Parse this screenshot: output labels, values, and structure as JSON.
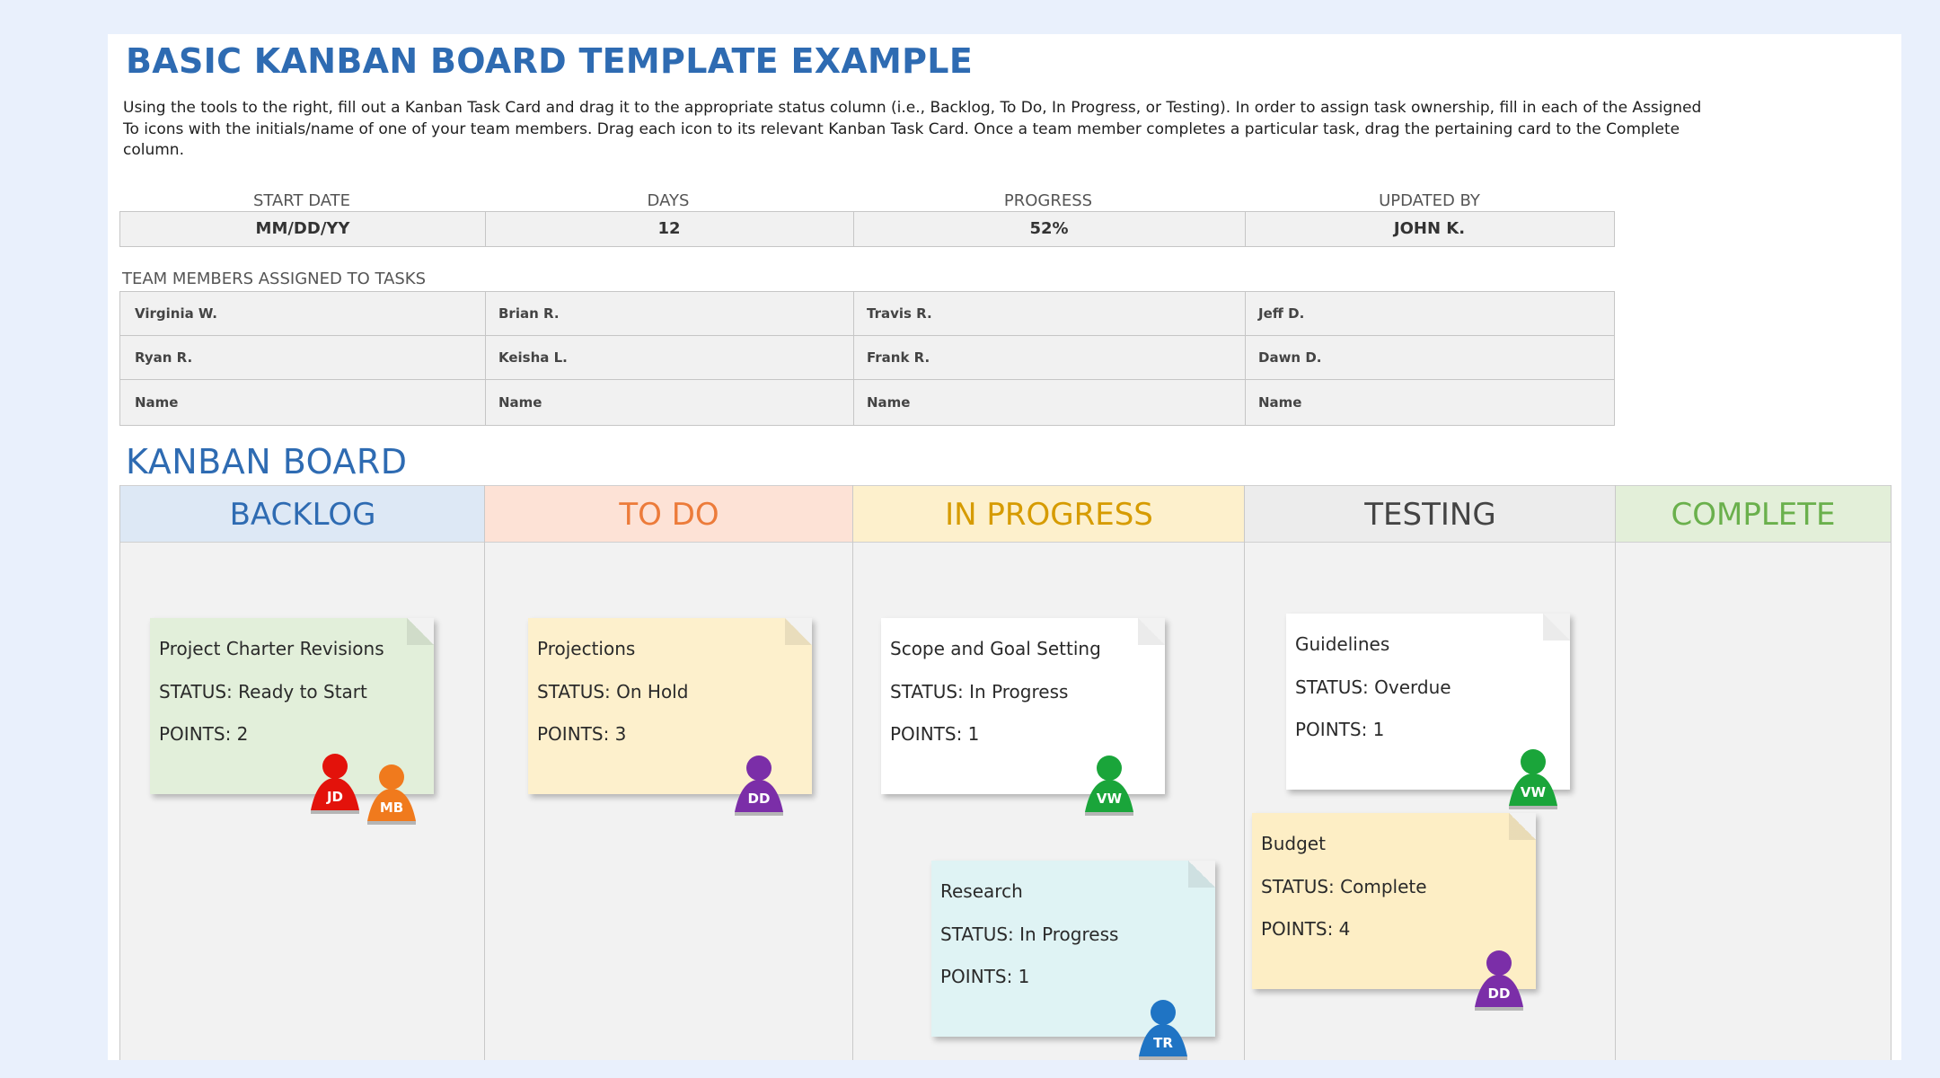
{
  "header": {
    "title": "BASIC KANBAN BOARD TEMPLATE EXAMPLE",
    "instructions": "Using the tools to the right, fill out a Kanban Task Card and drag it to the appropriate status column (i.e., Backlog, To Do, In Progress, or Testing). In order to assign task ownership, fill in each of the Assigned To icons with the initials/name of one of your team members. Drag each icon to its relevant Kanban Task Card. Once a team member completes a particular task, drag the pertaining card to the Complete column."
  },
  "summary": {
    "start_date_label": "START DATE",
    "start_date_value": "MM/DD/YY",
    "days_label": "DAYS",
    "days_value": "12",
    "progress_label": "PROGRESS",
    "progress_value": "52%",
    "updated_by_label": "UPDATED BY",
    "updated_by_value": "JOHN K."
  },
  "team": {
    "label": "TEAM MEMBERS ASSIGNED TO TASKS",
    "members": [
      [
        "Virginia W.",
        "Brian R.",
        "Travis R.",
        "Jeff D."
      ],
      [
        "Ryan R.",
        "Keisha L.",
        "Frank R.",
        "Dawn D."
      ],
      [
        "Name",
        "Name",
        "Name",
        "Name"
      ]
    ]
  },
  "board": {
    "title": "KANBAN BOARD",
    "columns": [
      {
        "label": "BACKLOG",
        "color": "#2e6bb2",
        "bg": "#dde8f5"
      },
      {
        "label": "TO DO",
        "color": "#ec7b3a",
        "bg": "#fde2d6"
      },
      {
        "label": "IN PROGRESS",
        "color": "#d69b00",
        "bg": "#fdf0cc"
      },
      {
        "label": "TESTING",
        "color": "#444444",
        "bg": "#ececec"
      },
      {
        "label": "COMPLETE",
        "color": "#6ab04c",
        "bg": "#e3efd9"
      }
    ],
    "cards": [
      {
        "title": "Project Charter Revisions",
        "status": "STATUS: Ready to Start",
        "points": "POINTS: 2",
        "color": "#e2efda"
      },
      {
        "title": "Projections",
        "status": "STATUS: On Hold",
        "points": "POINTS: 3",
        "color": "#fdf0cc"
      },
      {
        "title": "Scope and Goal Setting",
        "status": "STATUS: In Progress",
        "points": "POINTS: 1",
        "color": "#ffffff"
      },
      {
        "title": "Research",
        "status": "STATUS: In Progress",
        "points": "POINTS: 1",
        "color": "#dff3f4"
      },
      {
        "title": "Guidelines",
        "status": "STATUS: Overdue",
        "points": "POINTS: 1",
        "color": "#ffffff"
      },
      {
        "title": "Budget",
        "status": "STATUS: Complete",
        "points": "POINTS: 4",
        "color": "#fdeec5"
      }
    ],
    "assignees": [
      {
        "initials": "JD",
        "color": "#e3120b"
      },
      {
        "initials": "MB",
        "color": "#f07a1d"
      },
      {
        "initials": "DD",
        "color": "#7b2ea8"
      },
      {
        "initials": "VW",
        "color": "#1aa53a"
      },
      {
        "initials": "TR",
        "color": "#1f74c4"
      },
      {
        "initials": "VW",
        "color": "#1aa53a"
      },
      {
        "initials": "DD",
        "color": "#7b2ea8"
      }
    ]
  }
}
